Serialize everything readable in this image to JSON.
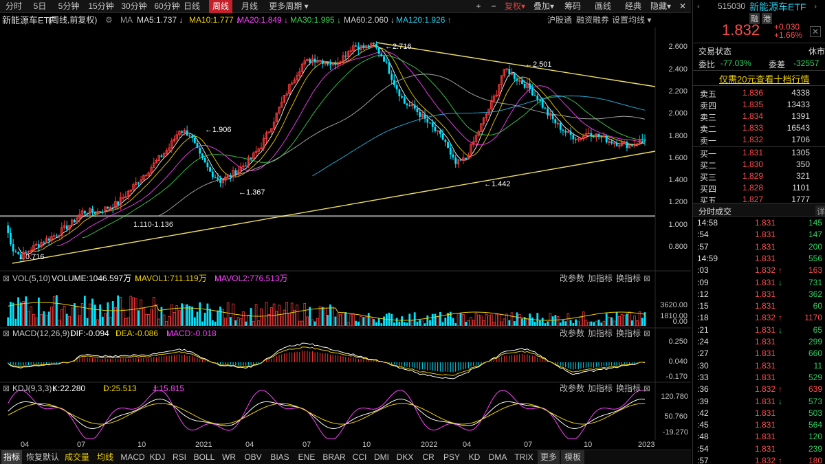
{
  "toolbar": {
    "periods": [
      "分时",
      "5日",
      "5分钟",
      "15分钟",
      "30分钟",
      "60分钟",
      "日线",
      "周线",
      "月线",
      "更多周期"
    ],
    "active_period": "周线",
    "plus": "+",
    "minus": "−",
    "fuquan": "复权",
    "overlay": "叠加",
    "chips": "筹码",
    "draw": "画线",
    "classic": "经典",
    "hide": "隐藏"
  },
  "legend": {
    "title": "新能源车ETF",
    "subtitle": "(周线,前复权)",
    "ma_label": "MA",
    "ma5": "MA5:1.737",
    "ma10": "MA10:1.777",
    "ma20": "MA20:1.849",
    "ma30": "MA30:1.995",
    "ma60": "MA60:2.060",
    "ma120": "MA120:1.926",
    "link1": "沪股通",
    "link2": "融资融券",
    "link3": "设置均线"
  },
  "colors": {
    "up": "#ff3b3b",
    "down": "#00e5ff",
    "ma5": "#ffffff",
    "ma10": "#f0d000",
    "ma20": "#ff40ff",
    "ma30": "#3cd34a",
    "ma60": "#b0b0b0",
    "ma120": "#27b7e8",
    "trend": "#f0e060"
  },
  "price_axis": [
    "2.600",
    "2.400",
    "2.200",
    "2.000",
    "1.800",
    "1.600",
    "1.400",
    "1.200",
    "1.000",
    "0.800"
  ],
  "annotations": {
    "high1": "1.906",
    "low1": "1.367",
    "high2": "2.716",
    "high3": "2.501",
    "low2": "1.442",
    "low0": "0.716",
    "range": "1.110-1.136"
  },
  "volume": {
    "label": "VOL(5,10)",
    "volume": "VOLUME:1046.597万",
    "mavol1": "MAVOL1:711.119万",
    "mavol2": "MAVOL2:776.513万",
    "axis": [
      "3620.00",
      "1810.00",
      "0.00"
    ]
  },
  "macd": {
    "label": "MACD(12,26,9)",
    "dif": "DIF:-0.094",
    "dea": "DEA:-0.086",
    "macd": "MACD:-0.018",
    "axis": [
      "0.250",
      "0.040",
      "-0.170"
    ]
  },
  "kdj": {
    "label": "KDJ(9,3,3)",
    "k": "K:22.280",
    "d": "D:25.513",
    "j": "J:15.815",
    "axis": [
      "120.780",
      "50.760",
      "-19.270"
    ]
  },
  "indicator_buttons": [
    "改参数",
    "加指标",
    "换指标"
  ],
  "x_axis": [
    "04",
    "07",
    "10",
    "2021",
    "04",
    "07",
    "10",
    "2022",
    "04",
    "07",
    "10",
    "2023"
  ],
  "bottom_tabs": [
    "指标",
    "恢复默认",
    "成交量",
    "均线",
    "MACD",
    "KDJ",
    "RSI",
    "BOLL",
    "WR",
    "OBV",
    "BIAS",
    "ENE",
    "BRAR",
    "CCI",
    "DMI",
    "DKX",
    "CR",
    "PSY",
    "KD",
    "DMA",
    "TRIX",
    "更多",
    "模板"
  ],
  "right": {
    "code": "515030",
    "name": "新能源车ETF",
    "tag1": "融",
    "tag2": "港",
    "price": "1.832",
    "change": "+0.030",
    "pct": "+1.66%",
    "status_label": "交易状态",
    "status_value": "休市",
    "webi_label": "委比",
    "webi_value": "-77.03%",
    "weicha_label": "委差",
    "weicha_value": "-32557",
    "promo": "仅需20元查看十档行情",
    "asks": [
      {
        "label": "卖五",
        "price": "1.836",
        "vol": "4338"
      },
      {
        "label": "卖四",
        "price": "1.835",
        "vol": "13433"
      },
      {
        "label": "卖三",
        "price": "1.834",
        "vol": "1391"
      },
      {
        "label": "卖二",
        "price": "1.833",
        "vol": "16543"
      },
      {
        "label": "卖一",
        "price": "1.832",
        "vol": "1706"
      }
    ],
    "bids": [
      {
        "label": "买一",
        "price": "1.831",
        "vol": "1305"
      },
      {
        "label": "买二",
        "price": "1.830",
        "vol": "350"
      },
      {
        "label": "买三",
        "price": "1.829",
        "vol": "321"
      },
      {
        "label": "买四",
        "price": "1.828",
        "vol": "1101"
      },
      {
        "label": "买五",
        "price": "1.827",
        "vol": "1777"
      }
    ],
    "ticks_title": "分时成交",
    "ticks_detail": "详",
    "ticks": [
      {
        "t": "14:58",
        "p": "1.831",
        "a": "",
        "v": "145",
        "c": "green",
        "pc": "red"
      },
      {
        "t": ":54",
        "p": "1.831",
        "a": "",
        "v": "147",
        "c": "green",
        "pc": "red"
      },
      {
        "t": ":57",
        "p": "1.831",
        "a": "",
        "v": "200",
        "c": "green",
        "pc": "red"
      },
      {
        "t": "14:59",
        "p": "1.831",
        "a": "",
        "v": "556",
        "c": "green",
        "pc": "red"
      },
      {
        "t": ":03",
        "p": "1.832",
        "a": "↑",
        "v": "163",
        "c": "red",
        "pc": "red"
      },
      {
        "t": ":09",
        "p": "1.831",
        "a": "↓",
        "v": "731",
        "c": "green",
        "pc": "red"
      },
      {
        "t": ":12",
        "p": "1.831",
        "a": "",
        "v": "362",
        "c": "green",
        "pc": "red"
      },
      {
        "t": ":15",
        "p": "1.831",
        "a": "",
        "v": "60",
        "c": "green",
        "pc": "red"
      },
      {
        "t": ":18",
        "p": "1.832",
        "a": "↑",
        "v": "1170",
        "c": "red",
        "pc": "red"
      },
      {
        "t": ":21",
        "p": "1.831",
        "a": "↓",
        "v": "65",
        "c": "green",
        "pc": "red"
      },
      {
        "t": ":24",
        "p": "1.831",
        "a": "",
        "v": "299",
        "c": "green",
        "pc": "red"
      },
      {
        "t": ":27",
        "p": "1.831",
        "a": "",
        "v": "660",
        "c": "green",
        "pc": "red"
      },
      {
        "t": ":30",
        "p": "1.831",
        "a": "",
        "v": "11",
        "c": "green",
        "pc": "red"
      },
      {
        "t": ":33",
        "p": "1.831",
        "a": "",
        "v": "529",
        "c": "green",
        "pc": "red"
      },
      {
        "t": ":36",
        "p": "1.832",
        "a": "↑",
        "v": "639",
        "c": "red",
        "pc": "red"
      },
      {
        "t": ":39",
        "p": "1.831",
        "a": "↓",
        "v": "573",
        "c": "green",
        "pc": "red"
      },
      {
        "t": ":42",
        "p": "1.831",
        "a": "",
        "v": "503",
        "c": "green",
        "pc": "red"
      },
      {
        "t": ":45",
        "p": "1.831",
        "a": "",
        "v": "564",
        "c": "green",
        "pc": "red"
      },
      {
        "t": ":48",
        "p": "1.831",
        "a": "",
        "v": "120",
        "c": "green",
        "pc": "red"
      },
      {
        "t": ":54",
        "p": "1.831",
        "a": "",
        "v": "239",
        "c": "green",
        "pc": "red"
      },
      {
        "t": ":57",
        "p": "1.832",
        "a": "↑",
        "v": "180",
        "c": "red",
        "pc": "red"
      }
    ]
  },
  "chart_data": {
    "type": "candlestick",
    "price_anchors": [
      {
        "date": "2020-03",
        "value": 0.716,
        "kind": "low"
      },
      {
        "date": "2020-10",
        "value": 1.11,
        "kind": "range-low"
      },
      {
        "date": "2021-02",
        "value": 1.906,
        "kind": "high"
      },
      {
        "date": "2021-04",
        "value": 1.367,
        "kind": "low"
      },
      {
        "date": "2021-12",
        "value": 2.716,
        "kind": "high"
      },
      {
        "date": "2022-04",
        "value": 1.442,
        "kind": "low"
      },
      {
        "date": "2022-07",
        "value": 2.501,
        "kind": "high"
      },
      {
        "date": "2023-01",
        "value": 1.832,
        "kind": "last"
      }
    ],
    "moving_averages": {
      "MA5": 1.737,
      "MA10": 1.777,
      "MA20": 1.849,
      "MA30": 1.995,
      "MA60": 2.06,
      "MA120": 1.926
    },
    "ylim": [
      0.7,
      2.72
    ],
    "grid": false
  }
}
